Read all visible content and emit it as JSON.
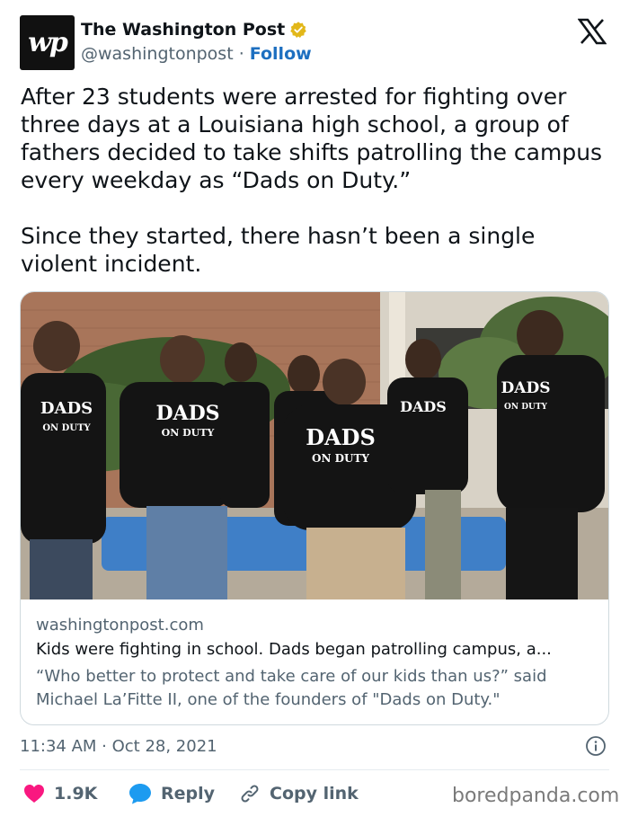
{
  "author": {
    "logo_text": "wp",
    "name": "The Washington Post",
    "handle": "@washingtonpost",
    "separator": " · ",
    "follow_label": "Follow"
  },
  "tweet": {
    "text": "After 23 students were arrested for fighting over three days at a Louisiana high school, a group of fathers decided to take shifts patrolling the campus every weekday as “Dads on Duty.”\n\nSince they started, there hasn’t been a single violent incident."
  },
  "card": {
    "shirt_text_1": "DADS",
    "shirt_text_2": "ON DUTY",
    "domain": "washingtonpost.com",
    "title": "Kids were fighting in school. Dads began patrolling campus, a...",
    "description": "“Who better to protect and take care of our kids than us?” said Michael La’Fitte II, one of the founders of \"Dads on Duty.\""
  },
  "meta": {
    "timestamp": "11:34 AM · Oct 28, 2021"
  },
  "actions": {
    "like_count": "1.9K",
    "reply_label": "Reply",
    "copy_link_label": "Copy link"
  },
  "watermark": "boredpanda.com",
  "colors": {
    "like": "#f91880",
    "reply": "#1d9bf0",
    "follow": "#1d6fc0",
    "verified": "#e2b719"
  }
}
